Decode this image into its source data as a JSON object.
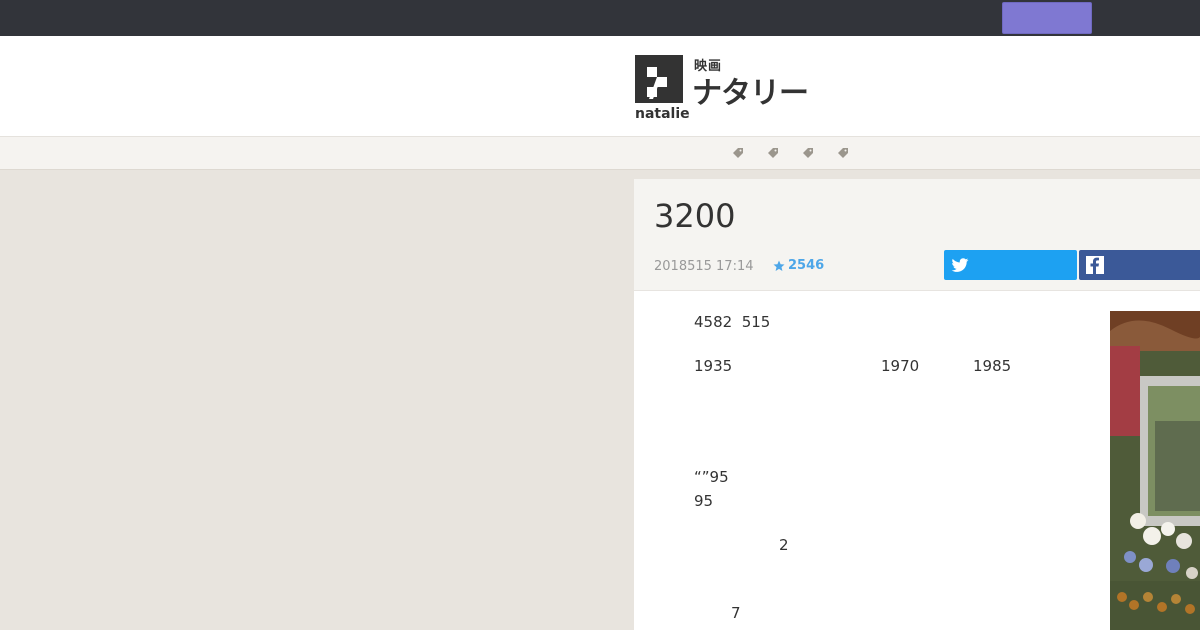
{
  "header": {
    "logo_sub": "映画",
    "logo_main": "ナタリー",
    "logo_word": "natalie"
  },
  "tag_nav": {
    "icons": [
      "tag-icon",
      "tag-icon",
      "tag-icon",
      "tag-icon"
    ]
  },
  "article": {
    "title": "3200",
    "date": "2018515 17:14",
    "stars": "2546",
    "body_lines": [
      "4582  515",
      "1935",
      "1970",
      "1985",
      "“”95",
      "95",
      "2",
      "7"
    ]
  },
  "share": {
    "twitter_icon": "twitter-icon",
    "facebook_icon": "facebook-icon"
  },
  "colors": {
    "topbar": "#32343a",
    "accent_button": "#7f78d2",
    "twitter": "#1da1f2",
    "facebook": "#3b5998",
    "star": "#4da6e8"
  }
}
